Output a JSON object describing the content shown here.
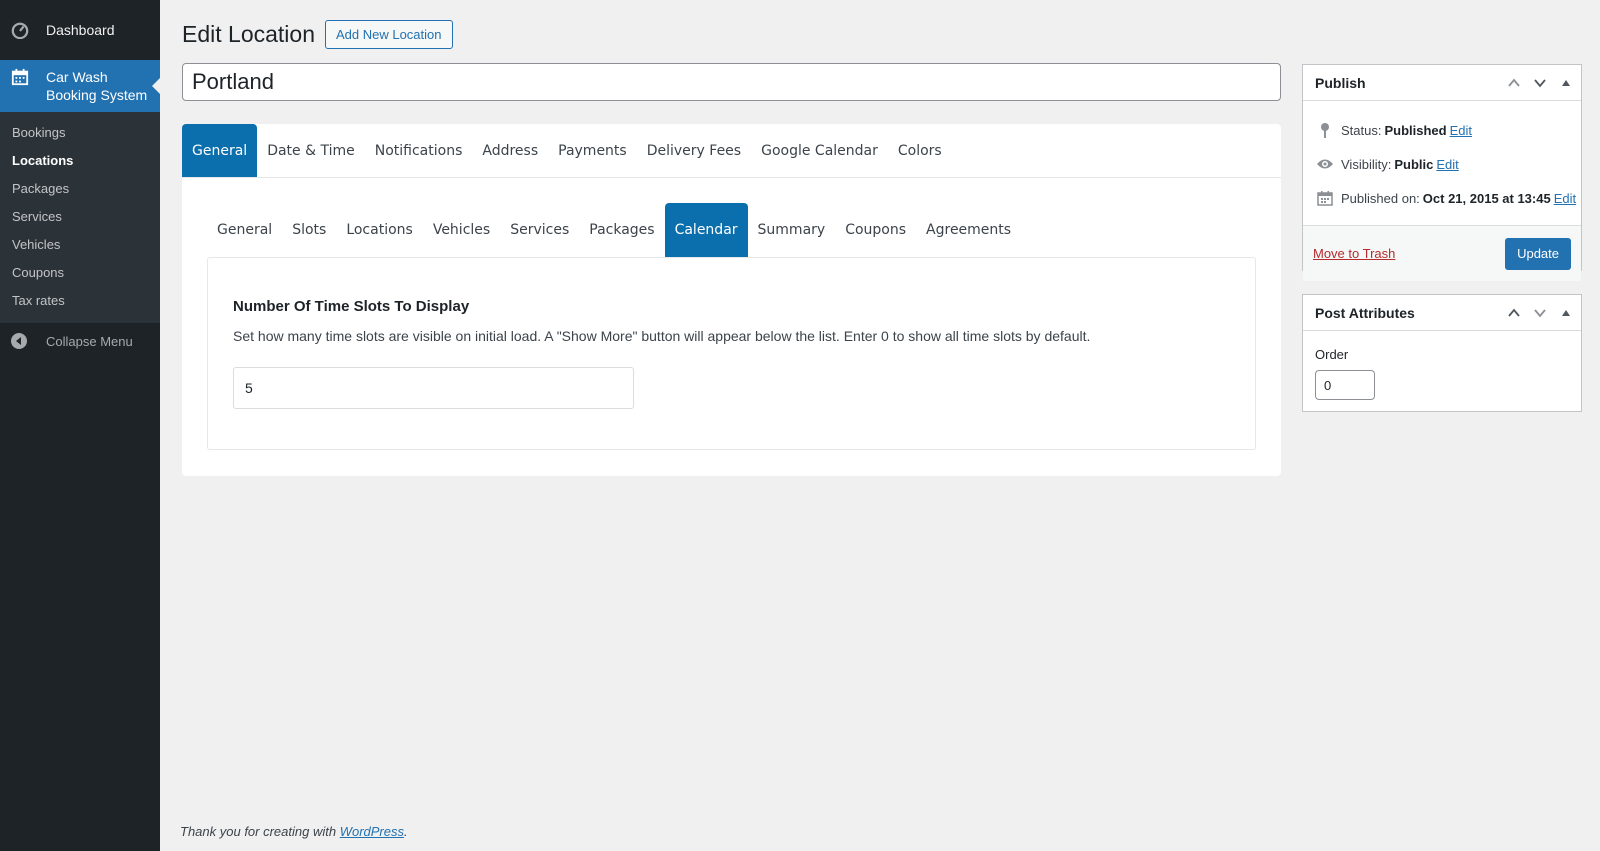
{
  "sidebar": {
    "dashboard_label": "Dashboard",
    "plugin_label_line1": "Car Wash",
    "plugin_label_line2": "Booking System",
    "submenu": [
      "Bookings",
      "Locations",
      "Packages",
      "Services",
      "Vehicles",
      "Coupons",
      "Tax rates"
    ],
    "active_submenu": "Locations",
    "collapse_label": "Collapse Menu"
  },
  "page": {
    "title": "Edit Location",
    "add_new_label": "Add New Location",
    "post_title": "Portland"
  },
  "tabs_primary": [
    "General",
    "Date & Time",
    "Notifications",
    "Address",
    "Payments",
    "Delivery Fees",
    "Google Calendar",
    "Colors"
  ],
  "tabs_primary_active": "General",
  "tabs_secondary": [
    "General",
    "Slots",
    "Locations",
    "Vehicles",
    "Services",
    "Packages",
    "Calendar",
    "Summary",
    "Coupons",
    "Agreements"
  ],
  "tabs_secondary_active": "Calendar",
  "setting": {
    "heading": "Number Of Time Slots To Display",
    "description": "Set how many time slots are visible on initial load. A \"Show More\" button will appear below the list. Enter 0 to show all time slots by default.",
    "value": "5"
  },
  "publish": {
    "title": "Publish",
    "status_label": "Status:",
    "status_value": "Published",
    "visibility_label": "Visibility:",
    "visibility_value": "Public",
    "published_label": "Published on:",
    "published_value": "Oct 21, 2015 at 13:45",
    "edit_label": "Edit",
    "trash_label": "Move to Trash",
    "update_label": "Update"
  },
  "attributes": {
    "title": "Post Attributes",
    "order_label": "Order",
    "order_value": "0"
  },
  "footer": {
    "text": "Thank you for creating with ",
    "link": "WordPress",
    "suffix": "."
  },
  "colors": {
    "sidebar_bg": "#1d2327",
    "accent": "#2271b1",
    "tab_active": "#0b6fad"
  }
}
